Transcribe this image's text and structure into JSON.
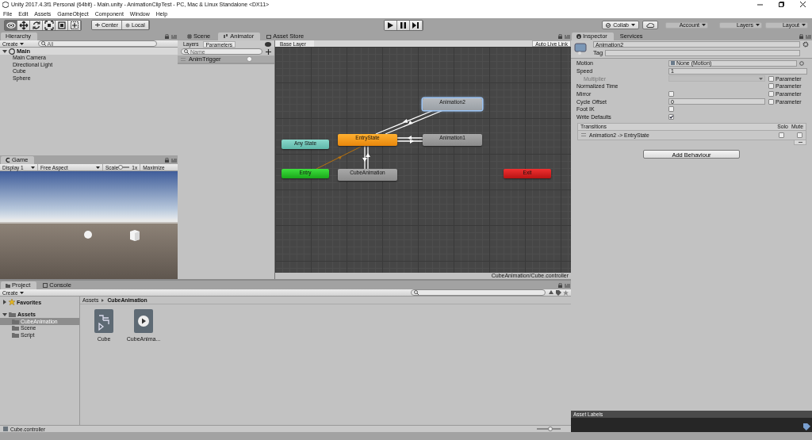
{
  "window": {
    "title": "Unity 2017.4.3f1 Personal (64bit) - Main.unity - AnimationClipTest - PC, Mac & Linux Standalone <DX11>"
  },
  "menu": [
    "File",
    "Edit",
    "Assets",
    "GameObject",
    "Component",
    "Window",
    "Help"
  ],
  "toolbar": {
    "tools": [
      {
        "selected": true
      },
      {
        "selected": false
      },
      {
        "selected": false
      },
      {
        "selected": false
      },
      {
        "selected": false
      },
      {
        "selected": false
      }
    ],
    "pivot": [
      {
        "label": "Center"
      },
      {
        "label": "Local"
      }
    ],
    "right": [
      {
        "label": "Collab",
        "kind": "collab"
      },
      {
        "kind": "cloud"
      },
      {
        "label": "Account",
        "kind": "dropdown"
      },
      {
        "label": "Layers",
        "kind": "dropdown"
      },
      {
        "label": "Layout",
        "kind": "dropdown"
      }
    ]
  },
  "hierarchy": {
    "tab": "Hierarchy",
    "create": "Create",
    "search": {
      "placeholder": "All"
    },
    "scene": "Main",
    "items": [
      "Main Camera",
      "Directional Light",
      "Cube",
      "Sphere"
    ]
  },
  "game": {
    "tab": "Game",
    "display": "Display 1",
    "aspect": "Free Aspect",
    "scale_label": "Scale",
    "scale_value": "1x",
    "maximize": "Maximize"
  },
  "animator": {
    "tabs": [
      {
        "label": "Scene",
        "selected": false
      },
      {
        "label": "Animator",
        "selected": true
      },
      {
        "label": "Asset Store",
        "selected": false
      }
    ],
    "side_tabs": [
      {
        "label": "Layers",
        "selected": false
      },
      {
        "label": "Parameters",
        "selected": true
      }
    ],
    "search": {
      "placeholder": "Name"
    },
    "parameters": [
      {
        "name": "AnimTrigger",
        "on": false
      }
    ],
    "breadcrumb": "Base Layer",
    "live_link": "Auto Live Link",
    "nodes": [
      {
        "label": "Animation2",
        "kind": "state",
        "selected": true
      },
      {
        "label": "EntryState",
        "kind": "default",
        "selected": false
      },
      {
        "label": "Animation1",
        "kind": "state",
        "selected": false
      },
      {
        "label": "Any State",
        "kind": "any",
        "selected": false
      },
      {
        "label": "Entry",
        "kind": "entry",
        "selected": false
      },
      {
        "label": "CubeAnimation",
        "kind": "state",
        "selected": false
      },
      {
        "label": "Exit",
        "kind": "exit",
        "selected": false
      }
    ],
    "footer": "CubeAnimation/Cube.controller"
  },
  "inspector": {
    "tabs": [
      {
        "label": "Inspector",
        "selected": true
      },
      {
        "label": "Services",
        "selected": false
      }
    ],
    "name": "Animation2",
    "tag_label": "Tag",
    "rows": [
      {
        "label": "Motion",
        "kind": "object",
        "value": "None (Motion)"
      },
      {
        "label": "Speed",
        "kind": "field",
        "value": "1"
      },
      {
        "label": "Multiplier",
        "kind": "dropdown",
        "disabled": true,
        "parameter": {
          "label": "Parameter",
          "checked": false
        }
      },
      {
        "label": "Normalized Time",
        "kind": "none",
        "parameter": {
          "label": "Parameter",
          "checked": false
        }
      },
      {
        "label": "Mirror",
        "kind": "checkbox",
        "checked": false,
        "parameter": {
          "label": "Parameter",
          "checked": false
        }
      },
      {
        "label": "Cycle Offset",
        "kind": "field",
        "value": "0",
        "parameter": {
          "label": "Parameter",
          "checked": false
        }
      },
      {
        "label": "Foot IK",
        "kind": "checkbox",
        "checked": false
      },
      {
        "label": "Write Defaults",
        "kind": "checkbox",
        "checked": true
      }
    ],
    "transitions": {
      "title": "Transitions",
      "solo": "Solo",
      "mute": "Mute",
      "items": [
        {
          "label": "Animation2 -> EntryState",
          "solo": false,
          "mute": false
        }
      ]
    },
    "add_button": "Add Behaviour",
    "asset_labels": "Asset Labels"
  },
  "project": {
    "tabs": [
      {
        "label": "Project",
        "selected": true
      },
      {
        "label": "Console",
        "selected": false
      }
    ],
    "create": "Create",
    "tree": [
      {
        "label": "Favorites",
        "kind": "favorites",
        "expanded": false,
        "selected": false
      },
      {
        "label": "Assets",
        "kind": "folder",
        "expanded": true,
        "selected": false,
        "children": [
          {
            "label": "CubeAnimation",
            "selected": true
          },
          {
            "label": "Scene",
            "selected": false
          },
          {
            "label": "Script",
            "selected": false
          }
        ]
      }
    ],
    "breadcrumb": [
      "Assets",
      "CubeAnimation"
    ],
    "assets": [
      {
        "name": "Cube",
        "kind": "controller"
      },
      {
        "name": "CubeAnima...",
        "kind": "clip"
      }
    ],
    "footer": "Cube.controller",
    "size_slider": {
      "level": 0.55
    }
  }
}
